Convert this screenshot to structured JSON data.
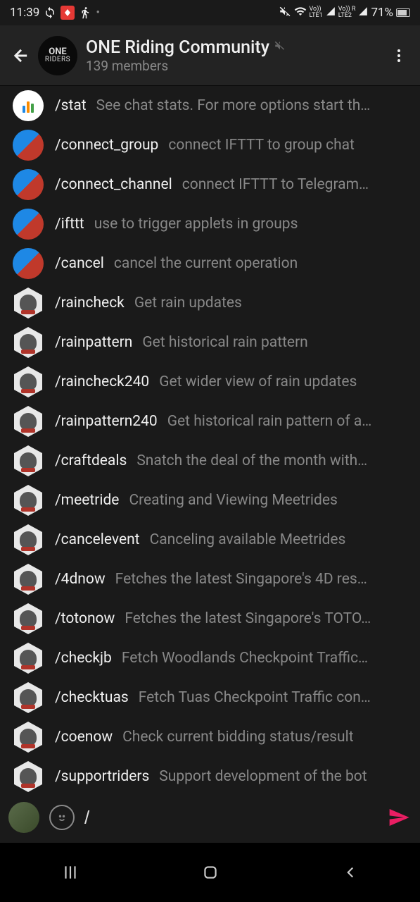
{
  "status": {
    "time": "11:39",
    "battery_pct": "71%",
    "lte1": "LTE1",
    "lte2": "LTE2",
    "vo": "Vo))",
    "r": "R"
  },
  "header": {
    "title": "ONE Riding Community",
    "subtitle": "139 members",
    "avatar_line1": "ONE",
    "avatar_line2": "RIDERS"
  },
  "commands": [
    {
      "name": "/stat",
      "desc": "See chat stats. For more options start th…",
      "avatar": "chart"
    },
    {
      "name": "/connect_group",
      "desc": "connect IFTTT to group chat",
      "avatar": "ifttt"
    },
    {
      "name": "/connect_channel",
      "desc": "connect IFTTT to Telegram…",
      "avatar": "ifttt"
    },
    {
      "name": "/ifttt",
      "desc": "use to trigger applets in groups",
      "avatar": "ifttt"
    },
    {
      "name": "/cancel",
      "desc": "cancel the current operation",
      "avatar": "ifttt"
    },
    {
      "name": "/raincheck",
      "desc": "Get rain updates",
      "avatar": "hex"
    },
    {
      "name": "/rainpattern",
      "desc": "Get historical rain pattern",
      "avatar": "hex"
    },
    {
      "name": "/raincheck240",
      "desc": "Get wider view of rain updates",
      "avatar": "hex"
    },
    {
      "name": "/rainpattern240",
      "desc": "Get historical rain pattern of a…",
      "avatar": "hex"
    },
    {
      "name": "/craftdeals",
      "desc": "Snatch the deal of the month with…",
      "avatar": "hex"
    },
    {
      "name": "/meetride",
      "desc": "Creating and Viewing Meetrides",
      "avatar": "hex"
    },
    {
      "name": "/cancelevent",
      "desc": "Canceling available Meetrides",
      "avatar": "hex"
    },
    {
      "name": "/4dnow",
      "desc": "Fetches the latest Singapore's 4D res…",
      "avatar": "hex"
    },
    {
      "name": "/totonow",
      "desc": "Fetches the latest Singapore's TOTO…",
      "avatar": "hex"
    },
    {
      "name": "/checkjb",
      "desc": "Fetch Woodlands Checkpoint Traffic…",
      "avatar": "hex"
    },
    {
      "name": "/checktuas",
      "desc": "Fetch Tuas Checkpoint Traffic con…",
      "avatar": "hex"
    },
    {
      "name": "/coenow",
      "desc": "Check current bidding status/result",
      "avatar": "hex"
    },
    {
      "name": "/supportriders",
      "desc": "Support development of the bot",
      "avatar": "hex"
    }
  ],
  "input": {
    "value": "/"
  }
}
